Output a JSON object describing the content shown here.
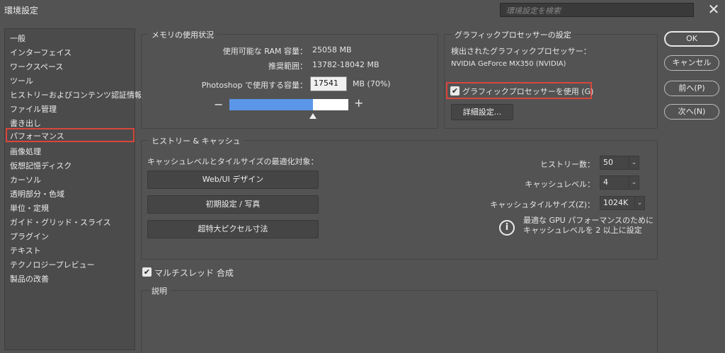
{
  "window": {
    "title": "環境設定",
    "search_placeholder": "環境設定を検索",
    "close_glyph": "✕"
  },
  "sidebar": {
    "items": [
      {
        "label": "一般"
      },
      {
        "label": "インターフェイス"
      },
      {
        "label": "ワークスペース"
      },
      {
        "label": "ツール"
      },
      {
        "label": "ヒストリーおよびコンテンツ認証情報"
      },
      {
        "label": "ファイル管理"
      },
      {
        "label": "書き出し"
      },
      {
        "label": "パフォーマンス",
        "selected": true
      },
      {
        "label": "画像処理"
      },
      {
        "label": "仮想記憶ディスク"
      },
      {
        "label": "カーソル"
      },
      {
        "label": "透明部分・色域"
      },
      {
        "label": "単位・定規"
      },
      {
        "label": "ガイド・グリッド・スライス"
      },
      {
        "label": "プラグイン"
      },
      {
        "label": "テキスト"
      },
      {
        "label": "テクノロジープレビュー"
      },
      {
        "label": "製品の改善"
      }
    ]
  },
  "memory": {
    "group_title": "メモリの使用状況",
    "available_label": "使用可能な RAM 容量：",
    "available_value": "25058 MB",
    "recommended_label": "推奨範囲：",
    "recommended_value": "13782-18042 MB",
    "photoshop_label": "Photoshop で使用する容量：",
    "photoshop_value": "17541",
    "photoshop_unit": "MB (70%)",
    "bar_fraction": 0.7,
    "minus": "−",
    "plus": "+"
  },
  "gpu": {
    "group_title": "グラフィックプロセッサーの設定",
    "detected_label": "検出されたグラフィックプロセッサー：",
    "detected_value": "NVIDIA GeForce MX350 (NVIDIA)",
    "use_gpu_label": "グラフィックプロセッサーを使用 (G)",
    "use_gpu_checked": true,
    "advanced_button": "詳細設定..."
  },
  "history_cache": {
    "group_title": "ヒストリー & キャッシュ",
    "optimize_label": "キャッシュレベルとタイルサイズの最適化対象：",
    "buttons": [
      "Web/UI デザイン",
      "初期設定 / 写真",
      "超特大ピクセル寸法"
    ],
    "history_states_label": "ヒストリー数：",
    "history_states_value": "50",
    "cache_levels_label": "キャッシュレベル：",
    "cache_levels_value": "4",
    "cache_tile_label": "キャッシュタイルサイズ(Z)：",
    "cache_tile_value": "1024K",
    "info_glyph": "i",
    "info_line1": "最適な GPU パフォーマンスのために",
    "info_line2": "キャッシュレベルを 2 以上に設定"
  },
  "multithreaded": {
    "label": "マルチスレッド 合成",
    "checked": true
  },
  "description": {
    "group_title": "説明"
  },
  "actions": {
    "ok": "OK",
    "cancel": "キャンセル",
    "prev": "前へ(P)",
    "next": "次へ(N)"
  }
}
